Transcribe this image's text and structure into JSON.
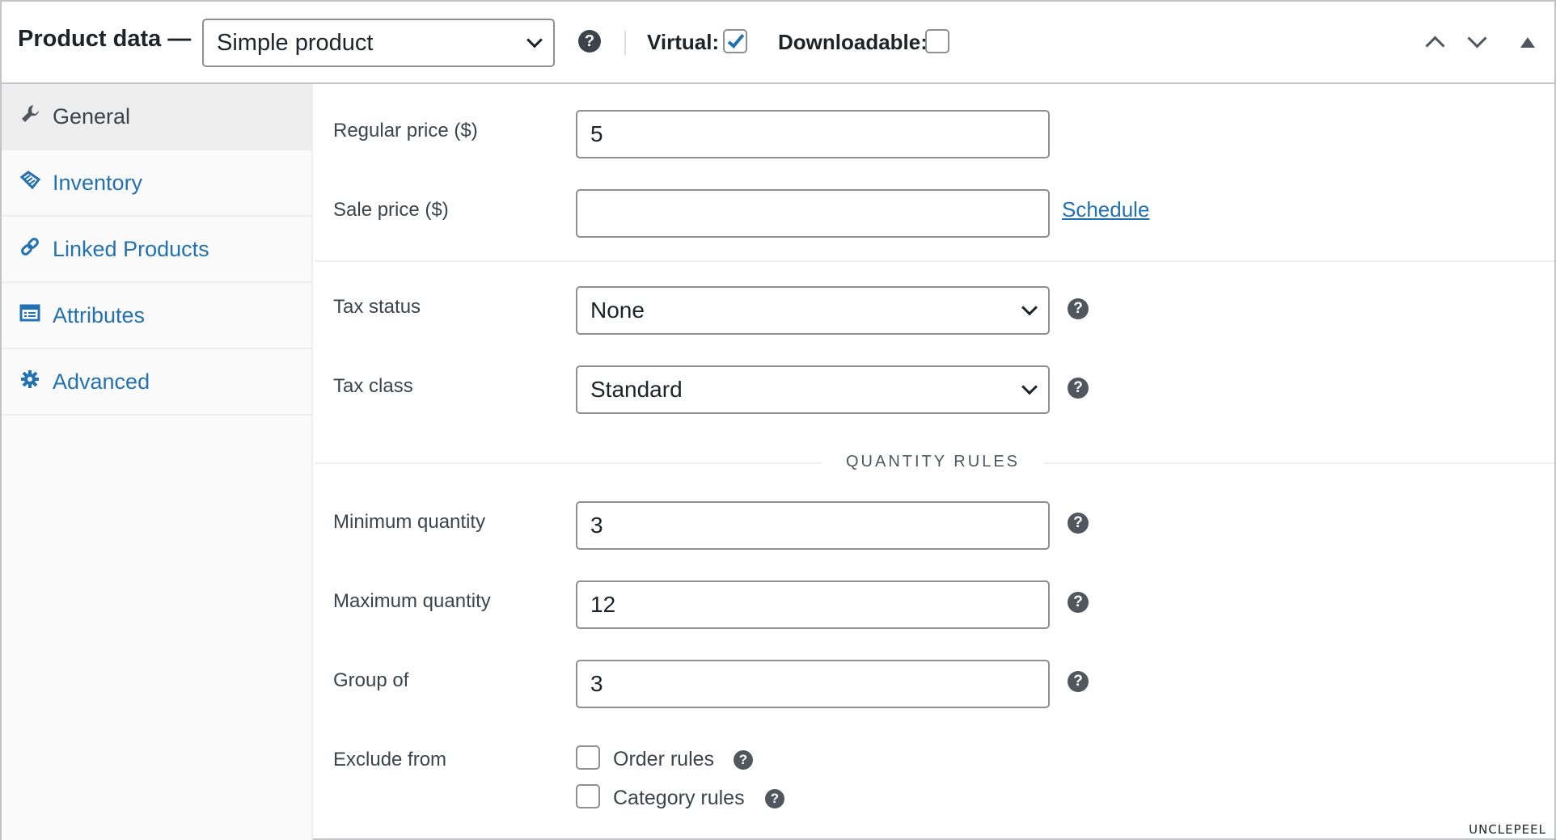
{
  "header": {
    "title": "Product data —",
    "product_type": "Simple product",
    "virtual_label": "Virtual:",
    "virtual_checked": true,
    "downloadable_label": "Downloadable:",
    "downloadable_checked": false
  },
  "sidebar": {
    "items": [
      {
        "label": "General",
        "icon": "wrench-icon",
        "active": true
      },
      {
        "label": "Inventory",
        "icon": "tag-icon",
        "active": false
      },
      {
        "label": "Linked Products",
        "icon": "link-icon",
        "active": false
      },
      {
        "label": "Attributes",
        "icon": "list-icon",
        "active": false
      },
      {
        "label": "Advanced",
        "icon": "gear-icon",
        "active": false
      }
    ]
  },
  "general": {
    "regular_price_label": "Regular price ($)",
    "regular_price_value": "5",
    "sale_price_label": "Sale price ($)",
    "sale_price_value": "",
    "schedule_link": "Schedule",
    "tax_status_label": "Tax status",
    "tax_status_value": "None",
    "tax_class_label": "Tax class",
    "tax_class_value": "Standard"
  },
  "quantity_rules": {
    "section_title": "QUANTITY RULES",
    "min_label": "Minimum quantity",
    "min_value": "3",
    "max_label": "Maximum quantity",
    "max_value": "12",
    "group_label": "Group of",
    "group_value": "3",
    "exclude_label": "Exclude from",
    "order_rules_label": "Order rules",
    "category_rules_label": "Category rules"
  },
  "help_glyph": "?",
  "watermark": "UNCLEPEEL",
  "colors": {
    "link": "#2271b1",
    "text": "#1d2327",
    "border": "#8c8f94",
    "sidebar_bg": "#fafafa",
    "active_tab_bg": "#eeeeee"
  }
}
